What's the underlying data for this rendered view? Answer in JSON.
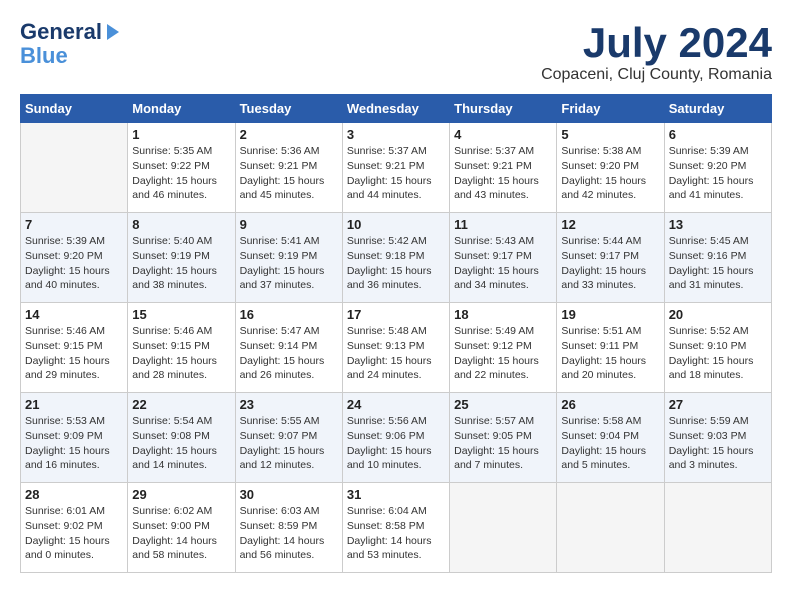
{
  "header": {
    "logo_line1": "General",
    "logo_line2": "Blue",
    "month_title": "July 2024",
    "location": "Copaceni, Cluj County, Romania"
  },
  "columns": [
    "Sunday",
    "Monday",
    "Tuesday",
    "Wednesday",
    "Thursday",
    "Friday",
    "Saturday"
  ],
  "weeks": [
    [
      {
        "day": "",
        "empty": true
      },
      {
        "day": "1",
        "sunrise": "Sunrise: 5:35 AM",
        "sunset": "Sunset: 9:22 PM",
        "daylight": "Daylight: 15 hours and 46 minutes."
      },
      {
        "day": "2",
        "sunrise": "Sunrise: 5:36 AM",
        "sunset": "Sunset: 9:21 PM",
        "daylight": "Daylight: 15 hours and 45 minutes."
      },
      {
        "day": "3",
        "sunrise": "Sunrise: 5:37 AM",
        "sunset": "Sunset: 9:21 PM",
        "daylight": "Daylight: 15 hours and 44 minutes."
      },
      {
        "day": "4",
        "sunrise": "Sunrise: 5:37 AM",
        "sunset": "Sunset: 9:21 PM",
        "daylight": "Daylight: 15 hours and 43 minutes."
      },
      {
        "day": "5",
        "sunrise": "Sunrise: 5:38 AM",
        "sunset": "Sunset: 9:20 PM",
        "daylight": "Daylight: 15 hours and 42 minutes."
      },
      {
        "day": "6",
        "sunrise": "Sunrise: 5:39 AM",
        "sunset": "Sunset: 9:20 PM",
        "daylight": "Daylight: 15 hours and 41 minutes."
      }
    ],
    [
      {
        "day": "7",
        "sunrise": "Sunrise: 5:39 AM",
        "sunset": "Sunset: 9:20 PM",
        "daylight": "Daylight: 15 hours and 40 minutes."
      },
      {
        "day": "8",
        "sunrise": "Sunrise: 5:40 AM",
        "sunset": "Sunset: 9:19 PM",
        "daylight": "Daylight: 15 hours and 38 minutes."
      },
      {
        "day": "9",
        "sunrise": "Sunrise: 5:41 AM",
        "sunset": "Sunset: 9:19 PM",
        "daylight": "Daylight: 15 hours and 37 minutes."
      },
      {
        "day": "10",
        "sunrise": "Sunrise: 5:42 AM",
        "sunset": "Sunset: 9:18 PM",
        "daylight": "Daylight: 15 hours and 36 minutes."
      },
      {
        "day": "11",
        "sunrise": "Sunrise: 5:43 AM",
        "sunset": "Sunset: 9:17 PM",
        "daylight": "Daylight: 15 hours and 34 minutes."
      },
      {
        "day": "12",
        "sunrise": "Sunrise: 5:44 AM",
        "sunset": "Sunset: 9:17 PM",
        "daylight": "Daylight: 15 hours and 33 minutes."
      },
      {
        "day": "13",
        "sunrise": "Sunrise: 5:45 AM",
        "sunset": "Sunset: 9:16 PM",
        "daylight": "Daylight: 15 hours and 31 minutes."
      }
    ],
    [
      {
        "day": "14",
        "sunrise": "Sunrise: 5:46 AM",
        "sunset": "Sunset: 9:15 PM",
        "daylight": "Daylight: 15 hours and 29 minutes."
      },
      {
        "day": "15",
        "sunrise": "Sunrise: 5:46 AM",
        "sunset": "Sunset: 9:15 PM",
        "daylight": "Daylight: 15 hours and 28 minutes."
      },
      {
        "day": "16",
        "sunrise": "Sunrise: 5:47 AM",
        "sunset": "Sunset: 9:14 PM",
        "daylight": "Daylight: 15 hours and 26 minutes."
      },
      {
        "day": "17",
        "sunrise": "Sunrise: 5:48 AM",
        "sunset": "Sunset: 9:13 PM",
        "daylight": "Daylight: 15 hours and 24 minutes."
      },
      {
        "day": "18",
        "sunrise": "Sunrise: 5:49 AM",
        "sunset": "Sunset: 9:12 PM",
        "daylight": "Daylight: 15 hours and 22 minutes."
      },
      {
        "day": "19",
        "sunrise": "Sunrise: 5:51 AM",
        "sunset": "Sunset: 9:11 PM",
        "daylight": "Daylight: 15 hours and 20 minutes."
      },
      {
        "day": "20",
        "sunrise": "Sunrise: 5:52 AM",
        "sunset": "Sunset: 9:10 PM",
        "daylight": "Daylight: 15 hours and 18 minutes."
      }
    ],
    [
      {
        "day": "21",
        "sunrise": "Sunrise: 5:53 AM",
        "sunset": "Sunset: 9:09 PM",
        "daylight": "Daylight: 15 hours and 16 minutes."
      },
      {
        "day": "22",
        "sunrise": "Sunrise: 5:54 AM",
        "sunset": "Sunset: 9:08 PM",
        "daylight": "Daylight: 15 hours and 14 minutes."
      },
      {
        "day": "23",
        "sunrise": "Sunrise: 5:55 AM",
        "sunset": "Sunset: 9:07 PM",
        "daylight": "Daylight: 15 hours and 12 minutes."
      },
      {
        "day": "24",
        "sunrise": "Sunrise: 5:56 AM",
        "sunset": "Sunset: 9:06 PM",
        "daylight": "Daylight: 15 hours and 10 minutes."
      },
      {
        "day": "25",
        "sunrise": "Sunrise: 5:57 AM",
        "sunset": "Sunset: 9:05 PM",
        "daylight": "Daylight: 15 hours and 7 minutes."
      },
      {
        "day": "26",
        "sunrise": "Sunrise: 5:58 AM",
        "sunset": "Sunset: 9:04 PM",
        "daylight": "Daylight: 15 hours and 5 minutes."
      },
      {
        "day": "27",
        "sunrise": "Sunrise: 5:59 AM",
        "sunset": "Sunset: 9:03 PM",
        "daylight": "Daylight: 15 hours and 3 minutes."
      }
    ],
    [
      {
        "day": "28",
        "sunrise": "Sunrise: 6:01 AM",
        "sunset": "Sunset: 9:02 PM",
        "daylight": "Daylight: 15 hours and 0 minutes."
      },
      {
        "day": "29",
        "sunrise": "Sunrise: 6:02 AM",
        "sunset": "Sunset: 9:00 PM",
        "daylight": "Daylight: 14 hours and 58 minutes."
      },
      {
        "day": "30",
        "sunrise": "Sunrise: 6:03 AM",
        "sunset": "Sunset: 8:59 PM",
        "daylight": "Daylight: 14 hours and 56 minutes."
      },
      {
        "day": "31",
        "sunrise": "Sunrise: 6:04 AM",
        "sunset": "Sunset: 8:58 PM",
        "daylight": "Daylight: 14 hours and 53 minutes."
      },
      {
        "day": "",
        "empty": true
      },
      {
        "day": "",
        "empty": true
      },
      {
        "day": "",
        "empty": true
      }
    ]
  ]
}
